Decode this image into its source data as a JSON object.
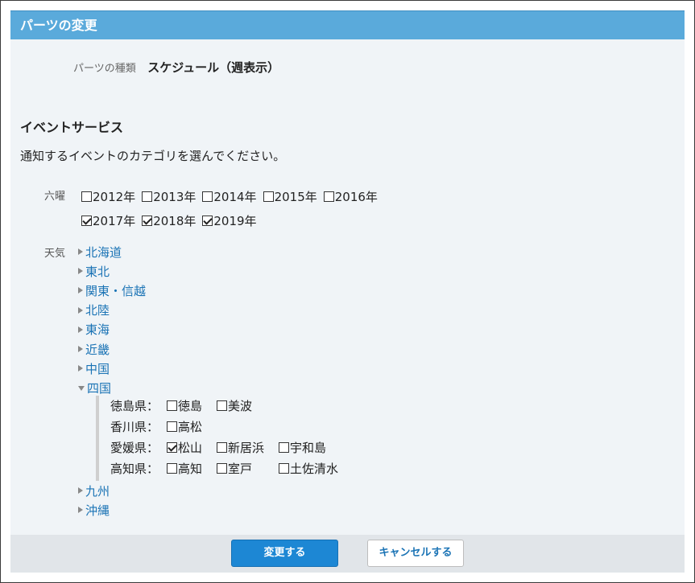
{
  "header": {
    "title": "パーツの変更"
  },
  "parts": {
    "label": "パーツの種類",
    "value": "スケジュール（週表示）"
  },
  "section": {
    "title": "イベントサービス",
    "description": "通知するイベントのカテゴリを選んでください。"
  },
  "rokuyo": {
    "label": "六曜",
    "years": [
      {
        "label": "2012年",
        "checked": false
      },
      {
        "label": "2013年",
        "checked": false
      },
      {
        "label": "2014年",
        "checked": false
      },
      {
        "label": "2015年",
        "checked": false
      },
      {
        "label": "2016年",
        "checked": false
      },
      {
        "label": "2017年",
        "checked": true
      },
      {
        "label": "2018年",
        "checked": true
      },
      {
        "label": "2019年",
        "checked": true
      }
    ]
  },
  "weather": {
    "label": "天気",
    "regions": [
      "北海道",
      "東北",
      "関東・信越",
      "北陸",
      "東海",
      "近畿",
      "中国",
      "四国",
      "九州",
      "沖縄"
    ],
    "expanded": "四国",
    "shikoku": [
      {
        "pref": "徳島県：",
        "cities": [
          {
            "label": "徳島",
            "checked": false
          },
          {
            "label": "美波",
            "checked": false
          }
        ]
      },
      {
        "pref": "香川県：",
        "cities": [
          {
            "label": "高松",
            "checked": false
          }
        ]
      },
      {
        "pref": "愛媛県：",
        "cities": [
          {
            "label": "松山",
            "checked": true
          },
          {
            "label": "新居浜",
            "checked": false
          },
          {
            "label": "宇和島",
            "checked": false
          }
        ]
      },
      {
        "pref": "高知県：",
        "cities": [
          {
            "label": "高知",
            "checked": false
          },
          {
            "label": "室戸",
            "checked": false
          },
          {
            "label": "土佐清水",
            "checked": false
          }
        ]
      }
    ]
  },
  "buttons": {
    "submit": "変更する",
    "cancel": "キャンセルする"
  }
}
